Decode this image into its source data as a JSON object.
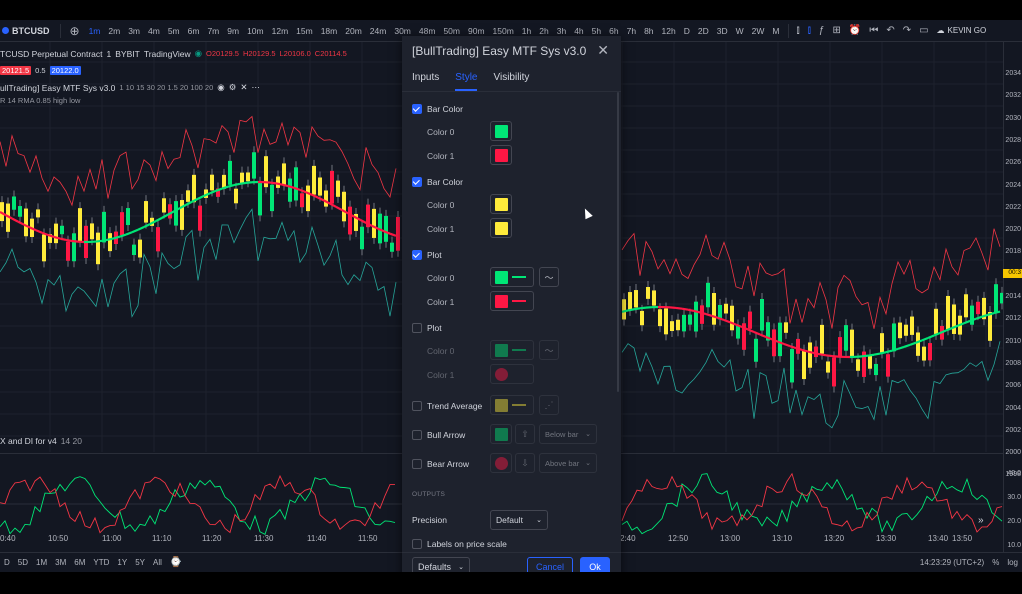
{
  "toolbar": {
    "symbol": "BTCUSD",
    "timeframes": [
      "1m",
      "2m",
      "3m",
      "4m",
      "5m",
      "6m",
      "7m",
      "9m",
      "10m",
      "12m",
      "15m",
      "18m",
      "20m",
      "24m",
      "30m",
      "48m",
      "50m",
      "90m",
      "150m",
      "1h",
      "2h",
      "3h",
      "4h",
      "5h",
      "6h",
      "7h",
      "8h",
      "12h",
      "D",
      "2D",
      "3D",
      "W",
      "2W",
      "M"
    ],
    "active_timeframe": "1m",
    "user": "KEVIN GO"
  },
  "legend": {
    "title": "TCUSD Perpetual Contract",
    "interval": "1",
    "exchange": "BYBIT",
    "platform": "TradingView",
    "ohlc": {
      "o": "O20129.5",
      "h": "H20129.5",
      "l": "L20106.0",
      "c": "C20114.5"
    },
    "price_left": "20121.5",
    "spread": "0.5",
    "price_right": "20122.0",
    "indicator": "ullTrading] Easy MTF Sys v3.0",
    "indicator_params": "1 10 15 30 20 1.5 20 100 20",
    "sub_indicator": "R 14 RMA 0.85 high low",
    "osc_title": "X and DI for v4",
    "osc_params": "14 20"
  },
  "price_axis": {
    "ticks": [
      "2034",
      "2032",
      "2030",
      "2028",
      "2026",
      "2024",
      "2022",
      "2020",
      "2018",
      "2016",
      "2014",
      "2012",
      "2010",
      "2008",
      "2006",
      "2004",
      "2002",
      "2000",
      "1998"
    ],
    "current_tag": "00:3",
    "osc_ticks": [
      "40.0",
      "30.0",
      "20.0",
      "10.0"
    ]
  },
  "time_axis": {
    "labels": [
      "0:40",
      "10:50",
      "11:00",
      "11:10",
      "11:20",
      "11:30",
      "11:40",
      "11:50",
      "2:40",
      "12:50",
      "13:00",
      "13:10",
      "13:20",
      "13:30",
      "13:40",
      "13:50"
    ]
  },
  "bottom": {
    "ranges": [
      "D",
      "5D",
      "1M",
      "3M",
      "6M",
      "YTD",
      "1Y",
      "5Y",
      "All"
    ],
    "clock": "14:23:29 (UTC+2)",
    "percent": "%",
    "log": "log"
  },
  "dialog": {
    "title": "[BullTrading] Easy MTF Sys v3.0",
    "tabs": [
      {
        "label": "Inputs",
        "active": false
      },
      {
        "label": "Style",
        "active": true
      },
      {
        "label": "Visibility",
        "active": false
      }
    ],
    "rows": {
      "bar_color_1": {
        "label": "Bar Color",
        "checked": true,
        "color0_label": "Color 0",
        "color0": "#00e676",
        "color1_label": "Color 1",
        "color1": "#ff1744"
      },
      "bar_color_2": {
        "label": "Bar Color",
        "checked": true,
        "color0_label": "Color 0",
        "color0": "#ffeb3b",
        "color1_label": "Color 1",
        "color1": "#ffeb3b"
      },
      "plot_1": {
        "label": "Plot",
        "checked": true,
        "color0_label": "Color 0",
        "color0": "#00e676",
        "color1_label": "Color 1",
        "color1": "#ff1744"
      },
      "plot_2": {
        "label": "Plot",
        "checked": false,
        "color0_label": "Color 0",
        "color0": "#00e676",
        "color1_label": "Color 1",
        "color1": "#ff1744"
      },
      "trend_average": {
        "label": "Trend Average",
        "checked": false,
        "color": "#ffeb3b"
      },
      "bull_arrow": {
        "label": "Bull Arrow",
        "checked": false,
        "color": "#00e676",
        "position": "Below bar"
      },
      "bear_arrow": {
        "label": "Bear Arrow",
        "checked": false,
        "color": "#ff1744",
        "position": "Above bar"
      }
    },
    "outputs_header": "OUTPUTS",
    "precision_label": "Precision",
    "precision_value": "Default",
    "labels_on_price_scale": "Labels on price scale",
    "footer": {
      "defaults": "Defaults",
      "cancel": "Cancel",
      "ok": "Ok"
    }
  },
  "colors": {
    "bg": "#131722",
    "accent": "#2962ff",
    "bull": "#00e676",
    "bear": "#ff1744",
    "neutral": "#ffeb3b",
    "band": "#f23645",
    "band_low": "#26a69a"
  }
}
